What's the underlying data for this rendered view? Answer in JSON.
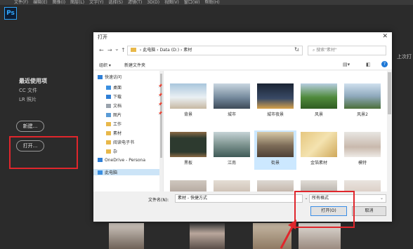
{
  "menubar": [
    "文件(F)",
    "编辑(E)",
    "图像(I)",
    "图层(L)",
    "文字(Y)",
    "选择(S)",
    "滤镜(T)",
    "3D(D)",
    "视图(V)",
    "窗口(W)",
    "帮助(H)"
  ],
  "ps_logo": "Ps",
  "home": {
    "recent_title": "最近使用项",
    "cc_files": "CC 文件",
    "lr_photos": "LR 照片",
    "new_button": "新建...",
    "open_button": "打开...",
    "right_hint": "上次打"
  },
  "dialog": {
    "title": "打开",
    "close": "✕",
    "nav": {
      "back": "←",
      "forward": "→",
      "recent": "⌄",
      "up": "↑"
    },
    "breadcrumb": [
      "此电脑",
      "Data (D:)",
      "素材"
    ],
    "search_placeholder": "搜索\"素材\"",
    "toolbar": {
      "organize": "组织 ▾",
      "new_folder": "新建文件夹"
    },
    "nav_pane": [
      {
        "label": "快速访问",
        "icon": "star-icon",
        "color": "#2f7fd6",
        "indent": 0
      },
      {
        "label": "桌面",
        "icon": "desktop-icon",
        "color": "#3b8fe0",
        "indent": 1,
        "pinned": true
      },
      {
        "label": "下载",
        "icon": "download-icon",
        "color": "#2f7fd6",
        "indent": 1,
        "pinned": true
      },
      {
        "label": "文档",
        "icon": "document-icon",
        "color": "#9aa3ad",
        "indent": 1,
        "pinned": true
      },
      {
        "label": "图片",
        "icon": "picture-icon",
        "color": "#5a9bd6",
        "indent": 1,
        "pinned": true
      },
      {
        "label": "工作",
        "icon": "folder-icon",
        "color": "#e8b84a",
        "indent": 1
      },
      {
        "label": "素材",
        "icon": "folder-icon",
        "color": "#e8b84a",
        "indent": 1
      },
      {
        "label": "阅读电子书",
        "icon": "folder-icon",
        "color": "#e8b84a",
        "indent": 1
      },
      {
        "label": "杂",
        "icon": "folder-icon",
        "color": "#e8b84a",
        "indent": 1
      },
      {
        "label": "OneDrive - Persona",
        "icon": "cloud-icon",
        "color": "#2f7fd6",
        "indent": 0
      },
      {
        "label": "此电脑",
        "icon": "computer-icon",
        "color": "#3b8fe0",
        "indent": 0,
        "selected": true
      }
    ],
    "files": [
      {
        "label": "背景",
        "bg": "linear-gradient(#a9c6dc,#eaf0f4 55%,#c7b8a2)"
      },
      {
        "label": "城市",
        "bg": "linear-gradient(#c9d6e0,#6f8497 60%,#3d4a57)"
      },
      {
        "label": "城市夜景",
        "bg": "linear-gradient(#1b2434,#394a66 60%,#d7a24a)"
      },
      {
        "label": "风景",
        "bg": "linear-gradient(#b7cde0,#4f8a3b 55%,#2f5c22)"
      },
      {
        "label": "风景2",
        "bg": "linear-gradient(#cfe0ee,#8fa9bd 50%,#4c6f3a)"
      },
      {
        "label": "黑板",
        "bg": "linear-gradient(#8a6a45,#2d3a2f 25%,#2d3a2f 80%,#8a6a45)"
      },
      {
        "label": "江南",
        "bg": "linear-gradient(#c6d3d6,#7f9591 50%,#3f5a57)"
      },
      {
        "label": "街景",
        "bg": "linear-gradient(#d8c9a6,#7c6b57 55%,#4e4136)",
        "selected": true
      },
      {
        "label": "金箔素材",
        "bg": "linear-gradient(135deg,#e6c77f,#f4e3b0 50%,#cfa85a)"
      },
      {
        "label": "模特",
        "bg": "linear-gradient(#e8e6e2,#c9b9ad 60%,#eeeae6)"
      },
      {
        "label": "",
        "bg": "linear-gradient(#cfc7bf,#9a8a80)"
      },
      {
        "label": "",
        "bg": "linear-gradient(#e4ddd4,#b7a395)"
      },
      {
        "label": "",
        "bg": "linear-gradient(#ddd8d2,#a88f7e)"
      },
      {
        "label": "",
        "bg": "linear-gradient(#e0dcd6,#8f847c)"
      },
      {
        "label": "",
        "bg": "linear-gradient(#e9e4df,#cdb8ab)"
      }
    ],
    "filename_label": "文件名(N):",
    "filename_value": "素材 - 快捷方式",
    "filetype": "所有格式",
    "open_button": "打开(O)",
    "cancel_button": "取消"
  }
}
